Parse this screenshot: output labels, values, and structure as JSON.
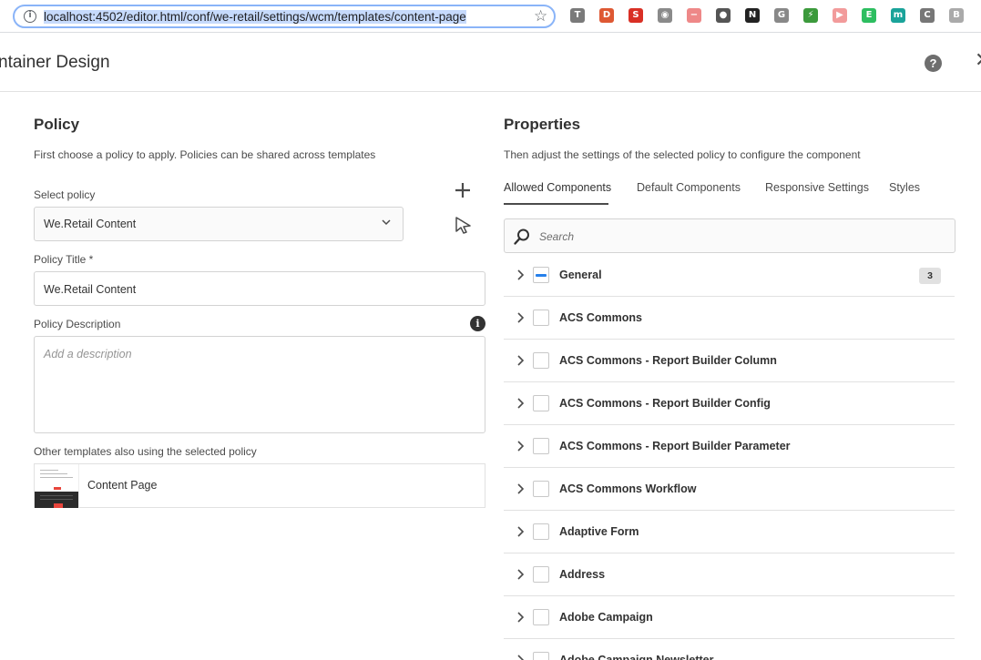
{
  "browser": {
    "url": "localhost:4502/editor.html/conf/we-retail/settings/wcm/templates/content-page",
    "extensions": [
      {
        "name": "t-icon",
        "glyph": "T",
        "color": "#7a7a7a"
      },
      {
        "name": "duckduckgo-icon",
        "glyph": "D",
        "color": "#de5833"
      },
      {
        "name": "red-ext-icon",
        "glyph": "S",
        "color": "#d93025"
      },
      {
        "name": "camera-icon",
        "glyph": "◉",
        "color": "#8a8a8a"
      },
      {
        "name": "minus-circle-icon",
        "glyph": "−",
        "color": "#e88"
      },
      {
        "name": "circle-icon",
        "glyph": "●",
        "color": "#555"
      },
      {
        "name": "n-icon",
        "glyph": "N",
        "color": "#222"
      },
      {
        "name": "g-icon",
        "glyph": "G",
        "color": "#888"
      },
      {
        "name": "leaf-icon",
        "glyph": "⚡",
        "color": "#3c9a3c"
      },
      {
        "name": "play-icon",
        "glyph": "▶",
        "color": "#f29b9b"
      },
      {
        "name": "evernote-icon",
        "glyph": "E",
        "color": "#2dbe60"
      },
      {
        "name": "m-icon",
        "glyph": "m",
        "color": "#1aa39a"
      },
      {
        "name": "c-icon",
        "glyph": "C",
        "color": "#777"
      },
      {
        "name": "b-icon",
        "glyph": "B",
        "color": "#aaa"
      }
    ]
  },
  "dialog": {
    "title": "Layout Container Design",
    "title_visible": "ntainer Design"
  },
  "policy": {
    "heading": "Policy",
    "description": "First choose a policy to apply. Policies can be shared across templates",
    "select_label": "Select policy",
    "selected_policy": "We.Retail Content",
    "title_label": "Policy Title *",
    "title_value": "We.Retail Content",
    "description_label": "Policy Description",
    "description_placeholder": "Add a description",
    "other_templates_label": "Other templates also using the selected policy",
    "other_templates": [
      {
        "name": "Content Page"
      }
    ]
  },
  "properties": {
    "heading": "Properties",
    "description": "Then adjust the settings of the selected policy to configure the component",
    "tabs": [
      {
        "label": "Allowed Components",
        "active": true
      },
      {
        "label": "Default Components",
        "active": false
      },
      {
        "label": "Responsive Settings",
        "active": false
      },
      {
        "label": "Styles",
        "active": false
      }
    ],
    "search_placeholder": "Search",
    "components": [
      {
        "label": "General",
        "state": "partial",
        "badge": "3"
      },
      {
        "label": "ACS Commons",
        "state": "unchecked"
      },
      {
        "label": "ACS Commons - Report Builder Column",
        "state": "unchecked"
      },
      {
        "label": "ACS Commons - Report Builder Config",
        "state": "unchecked"
      },
      {
        "label": "ACS Commons - Report Builder Parameter",
        "state": "unchecked"
      },
      {
        "label": "ACS Commons Workflow",
        "state": "unchecked"
      },
      {
        "label": "Adaptive Form",
        "state": "unchecked"
      },
      {
        "label": "Address",
        "state": "unchecked"
      },
      {
        "label": "Adobe Campaign",
        "state": "unchecked"
      },
      {
        "label": "Adobe Campaign Newsletter",
        "state": "unchecked"
      }
    ]
  }
}
